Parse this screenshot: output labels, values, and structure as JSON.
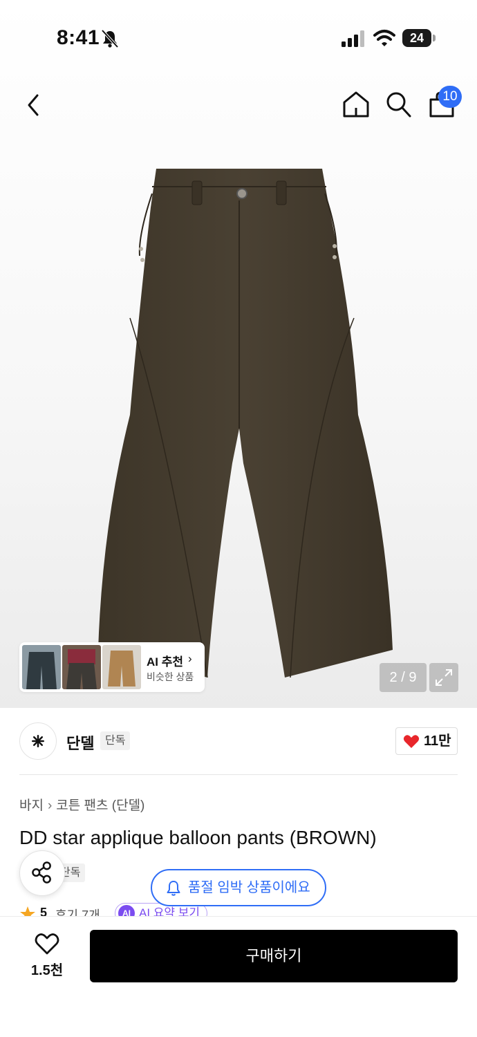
{
  "status_bar": {
    "time": "8:41",
    "battery": "24",
    "icons": [
      "bell-off-icon",
      "cellular-signal-icon",
      "wifi-icon",
      "battery-icon"
    ]
  },
  "nav": {
    "icons": [
      "back-chevron-icon",
      "home-icon",
      "search-icon",
      "shopping-bag-icon"
    ],
    "cart_badge": "10",
    "badge_color": "#2f6df6"
  },
  "gallery": {
    "page_counter": "2 / 9",
    "image_subject": "brown balloon pants",
    "ai_recommend": {
      "title": "AI 추천",
      "chevron": "›",
      "subtitle": "비슷한 상품"
    }
  },
  "brand": {
    "name": "단델",
    "tag": "단독",
    "likes": "11만",
    "heart_color": "#e8262b"
  },
  "product": {
    "breadcrumb": [
      "바지",
      "코튼 팬츠 (단델)"
    ],
    "breadcrumb_sep": "›",
    "title": "DD star applique balloon pants (BROWN)",
    "tag": "단독",
    "stock_notice": "품절 임박 상품이에요",
    "rating": "5",
    "reviews": "후기 7개",
    "ai_summary_badge": "AI",
    "ai_summary": "AI 요약 보기"
  },
  "bottom_bar": {
    "wish_count": "1.5천",
    "buy_label": "구매하기"
  },
  "colors": {
    "accent_blue": "#2f6df6",
    "ai_purple": "#7b4cf0",
    "star": "#f5a623",
    "buy_button": "#000000"
  }
}
